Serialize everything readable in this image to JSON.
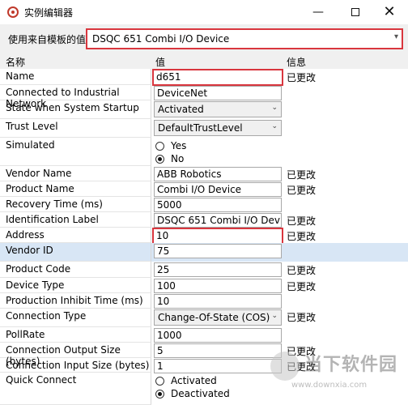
{
  "window": {
    "title": "实例编辑器"
  },
  "template": {
    "label": "使用来自模板的值",
    "value": "DSQC 651 Combi I/O Device"
  },
  "headers": {
    "name": "名称",
    "value": "值",
    "info": "信息"
  },
  "rows": [
    {
      "name": "Name",
      "value": "d651",
      "info": "已更改",
      "kind": "text",
      "highlight": true
    },
    {
      "name": "Connected to Industrial Network",
      "value": "DeviceNet",
      "info": "",
      "kind": "text"
    },
    {
      "name": "State when System Startup",
      "value": "Activated",
      "info": "",
      "kind": "combo"
    },
    {
      "name": "Trust Level",
      "value": "DefaultTrustLevel",
      "info": "",
      "kind": "combo"
    },
    {
      "name": "Simulated",
      "options": [
        "Yes",
        "No"
      ],
      "selected": "No",
      "info": "",
      "kind": "radio"
    },
    {
      "name": "Vendor Name",
      "value": "ABB Robotics",
      "info": "已更改",
      "kind": "text"
    },
    {
      "name": "Product Name",
      "value": "Combi I/O Device",
      "info": "已更改",
      "kind": "text"
    },
    {
      "name": "Recovery Time (ms)",
      "value": "5000",
      "info": "",
      "kind": "text"
    },
    {
      "name": "Identification Label",
      "value": "DSQC 651 Combi I/O Device",
      "info": "已更改",
      "kind": "text"
    },
    {
      "name": "Address",
      "value": "10",
      "info": "已更改",
      "kind": "text",
      "highlight": true
    },
    {
      "name": "Vendor ID",
      "value": "75",
      "info": "",
      "kind": "text",
      "selected_row": true
    },
    {
      "name": "Product Code",
      "value": "25",
      "info": "已更改",
      "kind": "text"
    },
    {
      "name": "Device Type",
      "value": "100",
      "info": "已更改",
      "kind": "text"
    },
    {
      "name": "Production Inhibit Time (ms)",
      "value": "10",
      "info": "",
      "kind": "text"
    },
    {
      "name": "Connection Type",
      "value": "Change-Of-State (COS)",
      "info": "已更改",
      "kind": "combo"
    },
    {
      "name": "PollRate",
      "value": "1000",
      "info": "",
      "kind": "text"
    },
    {
      "name": "Connection Output Size (bytes)",
      "value": "5",
      "info": "已更改",
      "kind": "text"
    },
    {
      "name": "Connection Input Size (bytes)",
      "value": "1",
      "info": "已更改",
      "kind": "text"
    },
    {
      "name": "Quick Connect",
      "options": [
        "Activated",
        "Deactivated"
      ],
      "selected": "Deactivated",
      "info": "",
      "kind": "radio"
    }
  ],
  "watermark": {
    "text": "当下软件园",
    "url": "www.downxia.com"
  },
  "icons": {
    "app": "app-logo-icon",
    "chevron": "chevron-down-icon",
    "minimize": "minimize-icon",
    "maximize": "maximize-icon",
    "close": "close-icon"
  }
}
